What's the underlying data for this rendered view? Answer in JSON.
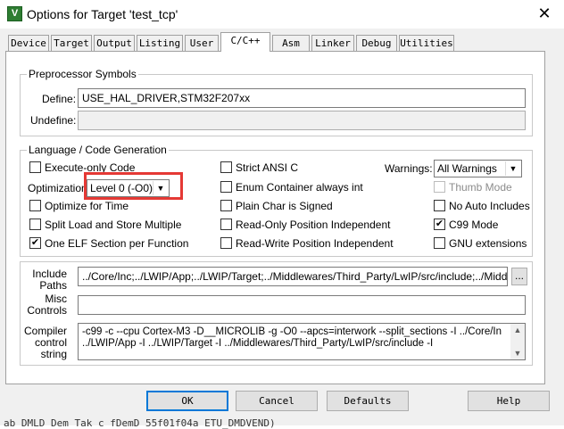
{
  "window": {
    "title": "Options for Target 'test_tcp'",
    "app_icon_glyph": "V",
    "close_glyph": "✕"
  },
  "tabs": [
    {
      "label": "Device"
    },
    {
      "label": "Target"
    },
    {
      "label": "Output"
    },
    {
      "label": "Listing"
    },
    {
      "label": "User"
    },
    {
      "label": "C/C++",
      "active": true
    },
    {
      "label": "Asm"
    },
    {
      "label": "Linker"
    },
    {
      "label": "Debug"
    },
    {
      "label": "Utilities"
    }
  ],
  "preprocessor": {
    "group_label": "Preprocessor Symbols",
    "define_label": "Define:",
    "define_value": "USE_HAL_DRIVER,STM32F207xx",
    "undefine_label": "Undefine:",
    "undefine_value": ""
  },
  "language": {
    "group_label": "Language / Code Generation",
    "execute_only": {
      "label": "Execute-only Code",
      "checked": false
    },
    "optimization_label": "Optimization:",
    "optimization_value": "Level 0 (-O0)",
    "optimize_time": {
      "label": "Optimize for Time",
      "checked": false
    },
    "split_load": {
      "label": "Split Load and Store Multiple",
      "checked": false
    },
    "one_elf": {
      "label": "One ELF Section per Function",
      "checked": true
    },
    "strict_ansi": {
      "label": "Strict ANSI C",
      "checked": false
    },
    "enum_container": {
      "label": "Enum Container always int",
      "checked": false
    },
    "plain_char": {
      "label": "Plain Char is Signed",
      "checked": false
    },
    "ro_pi": {
      "label": "Read-Only Position Independent",
      "checked": false
    },
    "rw_pi": {
      "label": "Read-Write Position Independent",
      "checked": false
    },
    "warnings_label": "Warnings:",
    "warnings_value": "All Warnings",
    "thumb_mode": {
      "label": "Thumb Mode",
      "checked": false,
      "disabled": true
    },
    "no_auto_includes": {
      "label": "No Auto Includes",
      "checked": false
    },
    "c99_mode": {
      "label": "C99 Mode",
      "checked": true
    },
    "gnu_extensions": {
      "label": "GNU extensions",
      "checked": false
    }
  },
  "paths": {
    "include_label_line1": "Include",
    "include_label_line2": "Paths",
    "include_value": "../Core/Inc;../LWIP/App;../LWIP/Target;../Middlewares/Third_Party/LwIP/src/include;../Middlewares",
    "browse_label": "...",
    "misc_label_line1": "Misc",
    "misc_label_line2": "Controls",
    "misc_value": ""
  },
  "compiler": {
    "label_line1": "Compiler",
    "label_line2": "control",
    "label_line3": "string",
    "line1": "-c99 -c --cpu Cortex-M3 -D__MICROLIB -g -O0 --apcs=interwork --split_sections -I ../Core/Inc -I",
    "line2": "../LWIP/App -I ../LWIP/Target -I ../Middlewares/Third_Party/LwIP/src/include -I"
  },
  "buttons": {
    "ok": "OK",
    "cancel": "Cancel",
    "defaults": "Defaults",
    "help": "Help"
  },
  "background_text": "ab DMLD Dem Tak c fDemD 55f01f04a ETU_DMDVEND)",
  "colors": {
    "highlight": "#e53935",
    "dialog_bg": "#f0f0f0"
  }
}
